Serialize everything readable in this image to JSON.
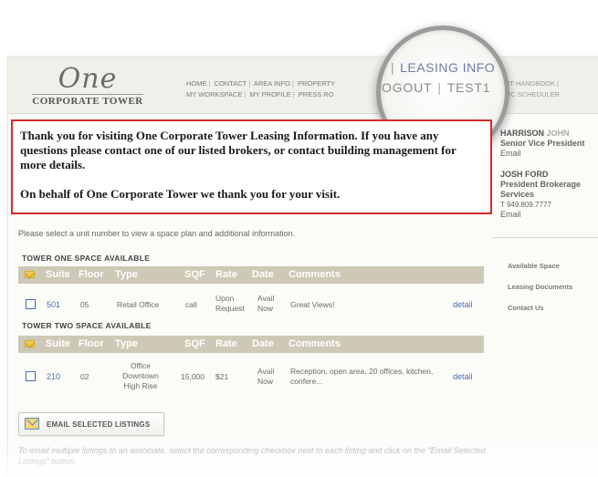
{
  "logo": {
    "script": "One",
    "subtitle": "CORPORATE TOWER"
  },
  "nav": {
    "row1": [
      "HOME",
      "CONTACT",
      "AREA INFO",
      "PROPERTY"
    ],
    "row2": [
      "MY WORKSPACE",
      "MY PROFILE",
      "PRESS RO"
    ],
    "right_row1": "ANT HANDBOOK  |",
    "right_row2": "BLIC SCHEDULER"
  },
  "magnifier": {
    "leasing_info": "LEASING INFO",
    "logout": "OGOUT",
    "user": "TEST1",
    "bar": "|"
  },
  "thanks": {
    "paragraph1": "Thank you for visiting One Corporate Tower Leasing Information.  If you have any questions please contact one of our listed brokers, or contact building management for more details.",
    "paragraph2": "On behalf of One Corporate Tower we thank you for your visit."
  },
  "brokers": [
    {
      "first": "HARRISON",
      "last": "JOHN",
      "title": "Senior Vice President",
      "title2": "",
      "phone": "",
      "email": "Email"
    },
    {
      "first": "JOSH FORD",
      "last": "",
      "title": "President Brokerage",
      "title2": "Services",
      "phone": "T 949.809.7777",
      "email": "Email"
    }
  ],
  "side_links": [
    "Available Space",
    "Leasing Documents",
    "Contact Us"
  ],
  "intro": "Please select a unit number to view a space plan and additional information.",
  "table_headers": [
    "Suite",
    "Floor",
    "Type",
    "SQF",
    "Rate",
    "Date",
    "Comments"
  ],
  "sections": [
    {
      "title": "TOWER ONE SPACE AVAILABLE",
      "rows": [
        {
          "suite": "501",
          "floor": "05",
          "type": "Retail Office",
          "sqf": "call",
          "rate": "Upon Request",
          "date": "Avail Now",
          "comments": "Great Views!",
          "detail": "detail"
        }
      ]
    },
    {
      "title": "TOWER TWO SPACE AVAILABLE",
      "rows": [
        {
          "suite": "210",
          "floor": "02",
          "type": "Office Downtown High Rise",
          "sqf": "15,000",
          "rate": "$21",
          "date": "Avail Now",
          "comments": "Reception, open area, 20 offices, kitchen, confere...",
          "detail": "detail"
        }
      ]
    }
  ],
  "email_button": "EMAIL SELECTED LISTINGS",
  "footnote": "To email multiple listings to an associate, select the corresponding checkbox next to each listing and click on the \"Email Selected Listings\" button.",
  "colors": {
    "highlight_border": "#d12c2c",
    "table_header": "#cdc9b6",
    "link": "#4a6fa5"
  }
}
